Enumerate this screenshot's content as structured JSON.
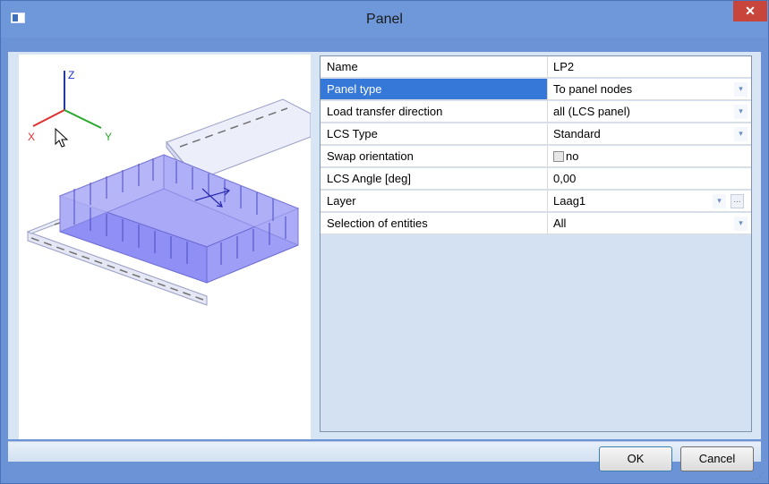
{
  "window": {
    "title": "Panel",
    "close_glyph": "✕"
  },
  "preview": {
    "axes": {
      "x": "X",
      "y": "Y",
      "z": "Z"
    },
    "axis_colors": {
      "x": "#e03030",
      "y": "#2aa830",
      "z": "#1d33d0"
    },
    "panel_color": "#8f8ff5",
    "icons": [
      "axes-icon",
      "mouse-cursor-icon",
      "lcs-arrows-icon"
    ]
  },
  "properties": {
    "rows": [
      {
        "name": "Name",
        "value": "LP2"
      },
      {
        "name": "Panel type",
        "value": "To panel nodes",
        "selected": true,
        "dropdown": true
      },
      {
        "name": "Load transfer direction",
        "value": "all (LCS panel)",
        "dropdown": true
      },
      {
        "name": "LCS Type",
        "value": "Standard",
        "dropdown": true
      },
      {
        "name": "Swap orientation",
        "value": "no",
        "checkbox": true,
        "checked": false
      },
      {
        "name": "LCS Angle [deg]",
        "value": "0,00"
      },
      {
        "name": "Layer",
        "value": "Laag1",
        "dropdown": true,
        "ellipsis": "..."
      },
      {
        "name": "Selection of entities",
        "value": "All",
        "dropdown": true
      }
    ],
    "dropdown_glyph": "▾"
  },
  "buttons": {
    "ok": "OK",
    "cancel": "Cancel"
  },
  "colors": {
    "titlebar": "#6f98da",
    "selection": "#3578d8",
    "close": "#c8453b"
  }
}
